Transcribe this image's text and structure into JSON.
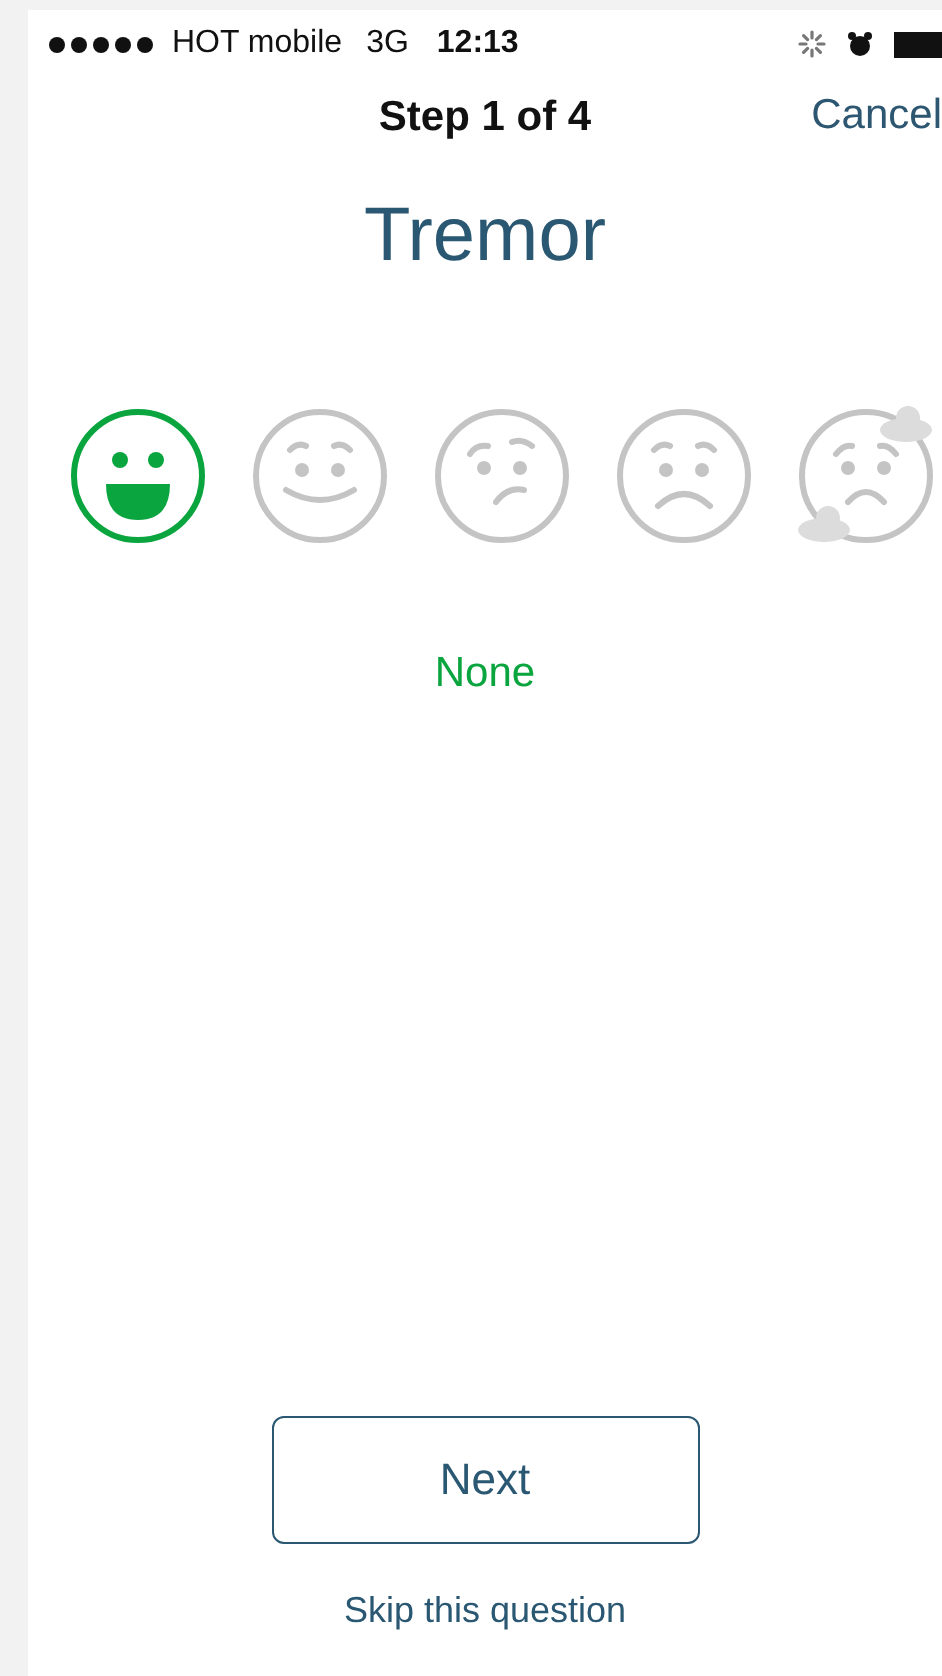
{
  "status_bar": {
    "carrier": "HOT mobile",
    "network": "3G",
    "time": "12:13"
  },
  "nav": {
    "title": "Step 1 of 4",
    "cancel": "Cancel"
  },
  "question": {
    "title": "Tremor"
  },
  "faces": [
    {
      "kind": "grin",
      "selected": true
    },
    {
      "kind": "smile",
      "selected": false
    },
    {
      "kind": "confused",
      "selected": false
    },
    {
      "kind": "sad",
      "selected": false
    },
    {
      "kind": "cloudy",
      "selected": false
    }
  ],
  "answer": "None",
  "next_button": "Next",
  "skip_link": "Skip this question"
}
